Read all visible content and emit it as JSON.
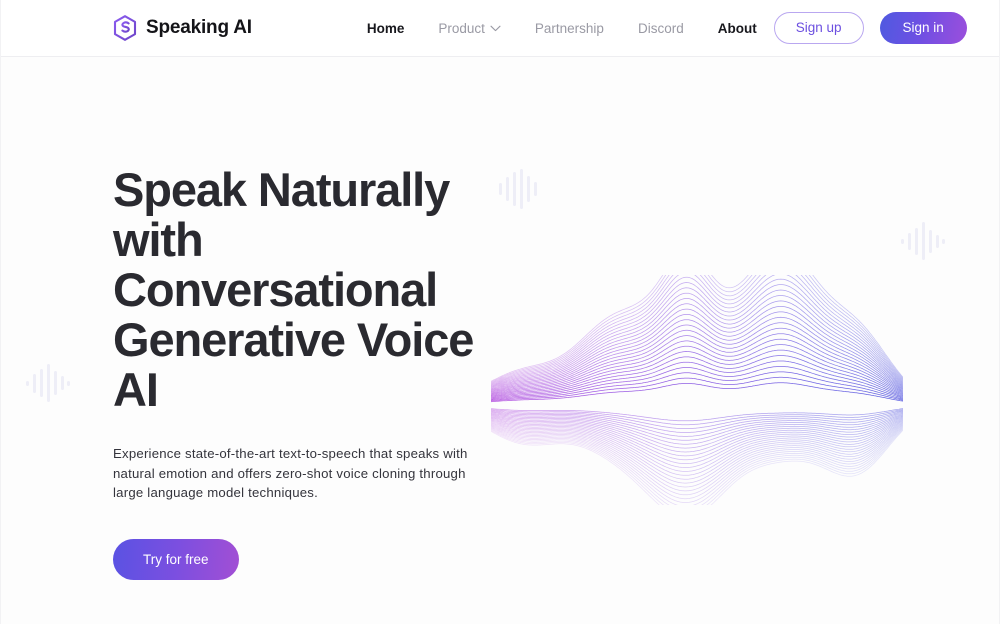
{
  "brand": {
    "name": "Speaking AI",
    "logo_icon": "speaking-ai-s-logo",
    "logo_color": "#7b52d6"
  },
  "nav": {
    "items": [
      {
        "label": "Home",
        "active": true,
        "has_dropdown": false
      },
      {
        "label": "Product",
        "active": false,
        "has_dropdown": true
      },
      {
        "label": "Partnership",
        "active": false,
        "has_dropdown": false
      },
      {
        "label": "Discord",
        "active": false,
        "has_dropdown": false
      },
      {
        "label": "About",
        "active": true,
        "has_dropdown": false
      }
    ],
    "dropdown_icon": "chevron-down-icon"
  },
  "actions": {
    "sign_up_label": "Sign up",
    "sign_in_label": "Sign in",
    "sign_up_border_color": "#b9a7f0",
    "sign_up_text_color": "#6c4fe0",
    "sign_in_gradient_from": "#4f5ae0",
    "sign_in_gradient_to": "#9b4fdc"
  },
  "hero": {
    "title": "Speak Naturally with Conversational Generative Voice AI",
    "subtitle": "Experience state-of-the-art text-to-speech that speaks with natural emotion and offers zero-shot voice cloning through large language model techniques.",
    "cta_label": "Try for free",
    "cta_gradient_from": "#5a52e3",
    "cta_gradient_to": "#a24fd4",
    "title_color": "#2a2a30"
  },
  "decoration": {
    "waveform_icon": "audio-waveform-illustration",
    "waveform_color_left": "#b44fe0",
    "waveform_color_right": "#5a5ce0",
    "equalizer_icon": "audio-equalizer-icon",
    "equalizer_color": "#eeeef7",
    "equalizers": [
      {
        "name": "equalizer-top",
        "bars": [
          6,
          12,
          20,
          26,
          16,
          10,
          5
        ]
      },
      {
        "name": "equalizer-right",
        "bars": [
          4,
          10,
          16,
          26,
          18,
          11,
          5
        ]
      },
      {
        "name": "equalizer-left",
        "bars": [
          4,
          12,
          18,
          28,
          17,
          11,
          5
        ]
      }
    ]
  },
  "page": {
    "background": "#fdfdfd",
    "header_background": "#ffffff",
    "header_border": "#eeeef1"
  }
}
